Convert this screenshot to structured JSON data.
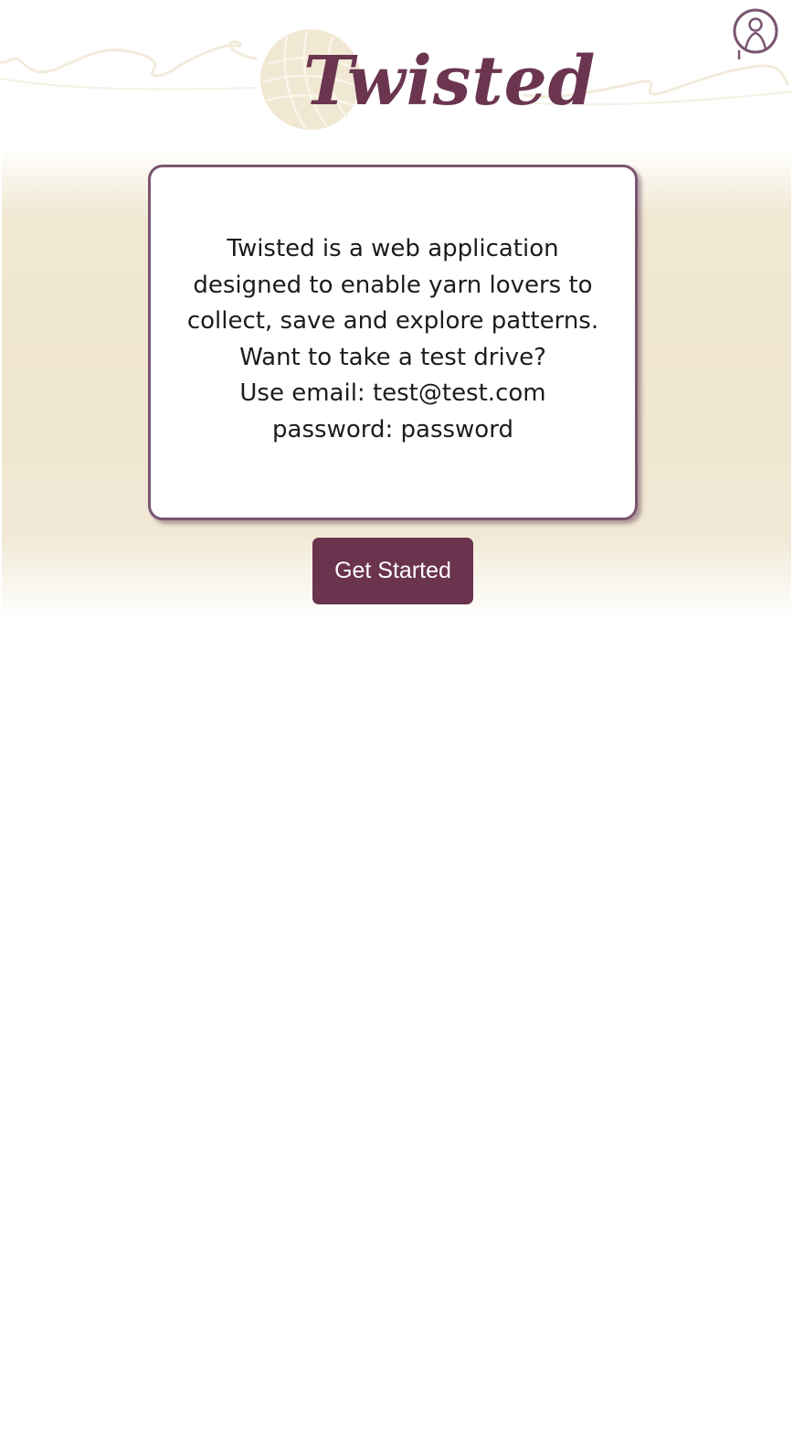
{
  "brand": {
    "logo_text": "Twisted",
    "logo_ball_color": "#f1e8d3",
    "accent_color": "#6a334e"
  },
  "header": {
    "profile_icon": "user-profile-icon"
  },
  "intro": {
    "lines": [
      "Twisted is a web application",
      "designed to enable yarn lovers to",
      "collect, save and explore patterns.",
      "Want to take a test drive?",
      "Use email: test@test.com",
      "password: password"
    ]
  },
  "cta": {
    "label": "Get Started"
  }
}
